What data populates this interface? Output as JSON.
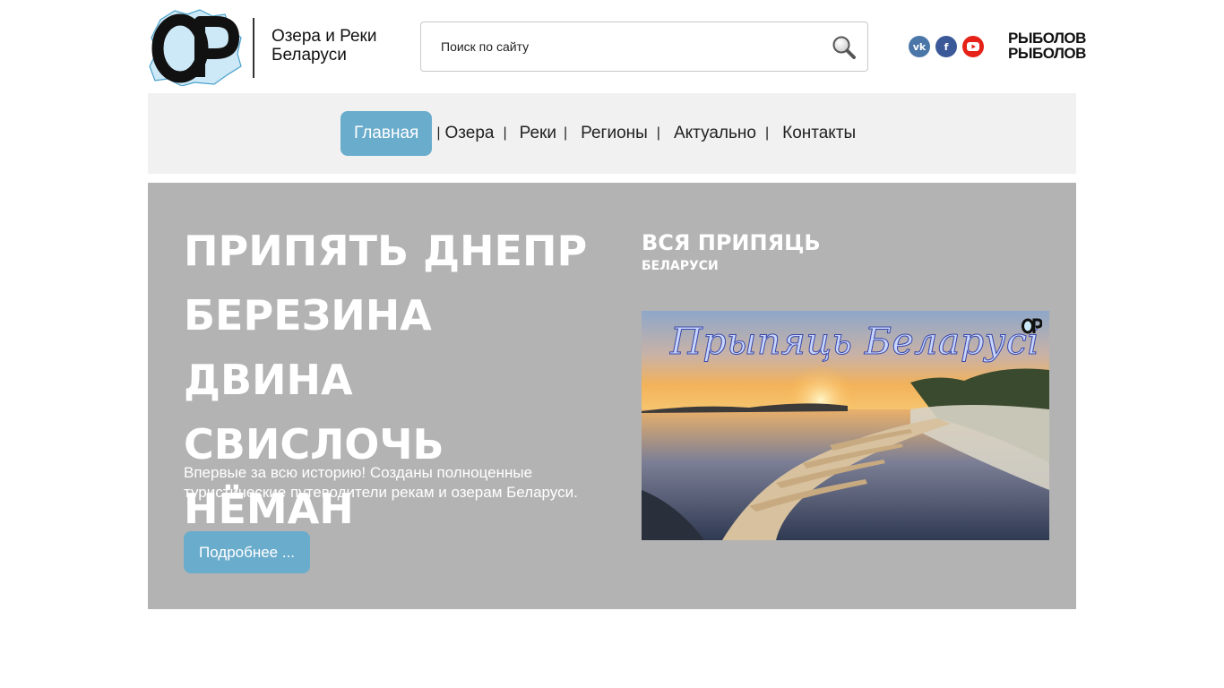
{
  "site": {
    "logo_letters": "ОР",
    "name_line1": "Озера и Реки",
    "name_line2": "Беларуси"
  },
  "search": {
    "placeholder": "Поиск по сайту",
    "icon": "search-icon"
  },
  "social": [
    {
      "name": "vk",
      "glyph": "vk",
      "color": "#4a76a8"
    },
    {
      "name": "facebook",
      "glyph": "f",
      "color": "#3b5998"
    },
    {
      "name": "youtube",
      "glyph": "▶",
      "color": "#e62117"
    }
  ],
  "partner": {
    "line1": "РЫБОЛОВ",
    "line2": "РЫБОЛОВ"
  },
  "nav": {
    "items": [
      {
        "label": "Главная",
        "active": true
      },
      {
        "label": "Озера",
        "active": false
      },
      {
        "label": "Реки",
        "active": false
      },
      {
        "label": "Регионы",
        "active": false
      },
      {
        "label": "Актуально",
        "active": false
      },
      {
        "label": "Контакты",
        "active": false
      }
    ],
    "separator": "|"
  },
  "hero": {
    "title_lines": [
      "ПРИПЯТЬ ДНЕПР",
      "БЕРЕЗИНА ДВИНА",
      "СВИСЛОЧЬ НЁМАН"
    ],
    "description": "Впервые за всю историю! Созданы полноценные туристические путеводители рекам и озерам Беларуси.",
    "more_label": "Подробнее ..."
  },
  "feature": {
    "title": "ВСЯ ПРИПЯЦЬ",
    "subtitle": "БЕЛАРУСИ",
    "image_caption": "Прыпяць Беларусі",
    "image_mark": "ОР"
  },
  "colors": {
    "accent": "#6aaccc",
    "hero_bg": "#b3b3b3",
    "nav_bg": "#f1f1f1"
  }
}
